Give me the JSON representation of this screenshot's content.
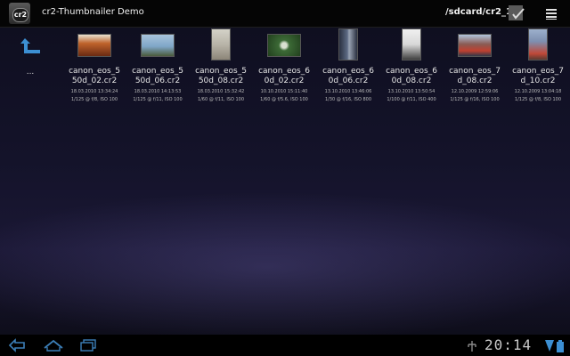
{
  "actionbar": {
    "app_icon_text": "cr2",
    "title": "cr2-Thumbnailer Demo",
    "path": "/sdcard/cr2_1",
    "icons": [
      "camera-app-icon",
      "select-check-icon",
      "overflow-menu-icon"
    ]
  },
  "navigation": {
    "up_label": "...",
    "up_icon": "up-arrow-icon"
  },
  "files": [
    {
      "name": "canon_eos_550d_02.cr2",
      "date": "18.03.2010 13:34:24",
      "exposure": "1/125 @ f/8, ISO 100",
      "thumb_color": "#c0642c",
      "orientation": "landscape"
    },
    {
      "name": "canon_eos_550d_06.cr2",
      "date": "18.03.2010 14:13:53",
      "exposure": "1/125 @ f/11, ISO 100",
      "thumb_color": "#7fa6c8",
      "orientation": "landscape"
    },
    {
      "name": "canon_eos_550d_08.cr2",
      "date": "18.03.2010 15:32:42",
      "exposure": "1/60 @ f/11, ISO 100",
      "thumb_color": "#b8b4a8",
      "orientation": "portrait"
    },
    {
      "name": "canon_eos_60d_02.cr2",
      "date": "10.10.2010 15:11:40",
      "exposure": "1/60 @ f/5.6, ISO 100",
      "thumb_color": "#3c6a36",
      "orientation": "landscape"
    },
    {
      "name": "canon_eos_60d_06.cr2",
      "date": "13.10.2010 13:46:06",
      "exposure": "1/30 @ f/16, ISO 800",
      "thumb_color": "#5c6a84",
      "orientation": "portrait"
    },
    {
      "name": "canon_eos_60d_08.cr2",
      "date": "13.10.2010 13:50:54",
      "exposure": "1/100 @ f/11, ISO 400",
      "thumb_color": "#d8d8d8",
      "orientation": "portrait"
    },
    {
      "name": "canon_eos_7d_08.cr2",
      "date": "12.10.2009 12:59:06",
      "exposure": "1/125 @ f/16, ISO 100",
      "thumb_color": "#8a5a52",
      "orientation": "landscape"
    },
    {
      "name": "canon_eos_7d_10.cr2",
      "date": "12.10.2009 13:04:18",
      "exposure": "1/125 @ f/8, ISO 100",
      "thumb_color": "#7d8fb0",
      "orientation": "portrait"
    }
  ],
  "system_bar": {
    "clock": "20:14",
    "icons": [
      "back-icon",
      "home-icon",
      "recent-apps-icon",
      "usb-debug-icon",
      "signal-icon",
      "battery-icon"
    ]
  }
}
